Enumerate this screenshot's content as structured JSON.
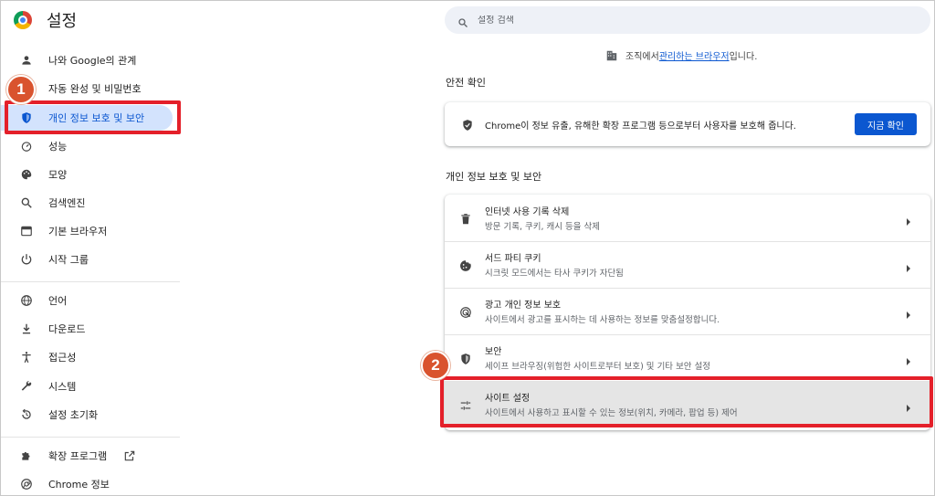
{
  "app": {
    "title": "설정"
  },
  "sidebar": {
    "items": [
      {
        "label": "나와 Google의 관계",
        "icon": "person-icon"
      },
      {
        "label": "자동 완성 및 비밀번호",
        "icon": "clipboard-icon"
      },
      {
        "label": "개인 정보 보호 및 보안",
        "icon": "shield-icon",
        "active": true
      },
      {
        "label": "성능",
        "icon": "speedometer-icon"
      },
      {
        "label": "모양",
        "icon": "palette-icon"
      },
      {
        "label": "검색엔진",
        "icon": "search-icon"
      },
      {
        "label": "기본 브라우저",
        "icon": "browser-icon"
      },
      {
        "label": "시작 그룹",
        "icon": "power-icon"
      },
      {
        "label": "언어",
        "icon": "globe-icon"
      },
      {
        "label": "다운로드",
        "icon": "download-icon"
      },
      {
        "label": "접근성",
        "icon": "accessibility-icon"
      },
      {
        "label": "시스템",
        "icon": "wrench-icon"
      },
      {
        "label": "설정 초기화",
        "icon": "reset-icon"
      },
      {
        "label": "확장 프로그램",
        "icon": "puzzle-icon"
      },
      {
        "label": "Chrome 정보",
        "icon": "chrome-icon"
      }
    ]
  },
  "badges": {
    "first": "1",
    "second": "2"
  },
  "search": {
    "placeholder": "설정 검색"
  },
  "managed": {
    "prefix": "조직에서 ",
    "link": "관리하는 브라우저",
    "suffix": "입니다."
  },
  "safety_check": {
    "section_title": "안전 확인",
    "text": "Chrome이 정보 유출, 유해한 확장 프로그램 등으로부터 사용자를 보호해 줍니다.",
    "button": "지금 확인"
  },
  "privacy": {
    "section_title": "개인 정보 보호 및 보안",
    "rows": [
      {
        "title": "인터넷 사용 기록 삭제",
        "desc": "방문 기록, 쿠키, 캐시 등을 삭제",
        "icon": "trash-icon"
      },
      {
        "title": "서드 파티 쿠키",
        "desc": "시크릿 모드에서는 타사 쿠키가 자단됨",
        "icon": "cookie-icon"
      },
      {
        "title": "광고 개인 정보 보호",
        "desc": "사이트에서 광고를 표시하는 데 사용하는 정보를 맞춤설정합니다.",
        "icon": "ad-privacy-icon"
      },
      {
        "title": "보안",
        "desc": "세이프 브라우징(위험한 사이트로부터 보호) 및 기타 보안 설정",
        "icon": "security-shield-icon"
      },
      {
        "title": "사이트 설정",
        "desc": "사이트에서 사용하고 표시할 수 있는 정보(위치, 카메라, 팝업 등) 제어",
        "icon": "tune-icon"
      }
    ]
  },
  "colors": {
    "accent": "#0b57d0",
    "highlight": "#e4202a",
    "badge": "#d9532e",
    "active_bg": "#d3e3fd"
  }
}
